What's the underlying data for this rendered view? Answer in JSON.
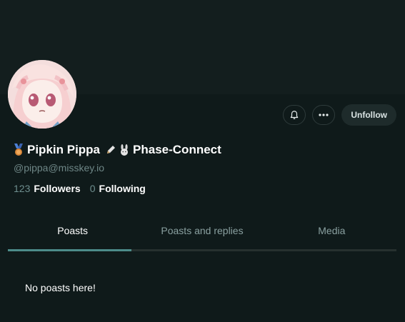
{
  "profile": {
    "display_name_prefix_icon": "medal-icon",
    "display_name": "Pipkin Pippa",
    "name_emoji_1": "pencil-icon",
    "name_emoji_2": "rabbit-icon",
    "display_name_suffix": "Phase-Connect",
    "handle": "@pippa@misskey.io"
  },
  "stats": {
    "followers_count": "123",
    "followers_label": "Followers",
    "following_count": "0",
    "following_label": "Following"
  },
  "actions": {
    "bell_icon": "bell-icon",
    "more_icon": "ellipsis-icon",
    "unfollow_label": "Unfollow"
  },
  "tabs": [
    {
      "label": "Poasts",
      "active": true
    },
    {
      "label": "Poasts and replies",
      "active": false
    },
    {
      "label": "Media",
      "active": false
    }
  ],
  "empty_state": {
    "message": "No poasts here!"
  },
  "colors": {
    "background": "#0f1a1a",
    "banner": "#131e1e",
    "accent": "#4d8c8a",
    "muted_text": "#6e8686"
  }
}
